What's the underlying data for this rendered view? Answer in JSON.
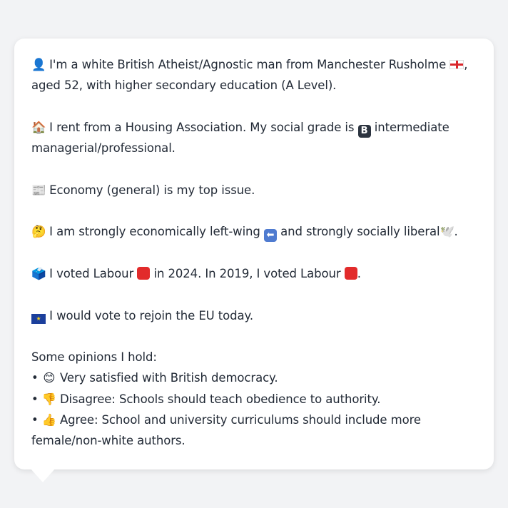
{
  "profile": {
    "line1a": "I'm a white British Atheist/Agnostic man from Manchester Rusholme",
    "line1b": "aged 52, with higher secondary education (A Level).",
    "line2a": "I rent from a Housing Association. My social grade is",
    "grade_badge": "B",
    "line2b": "intermediate",
    "line2c": "managerial/professional.",
    "line3": "Economy (general) is my top issue.",
    "line4a": "I am strongly economically left-wing",
    "line4b": "and strongly socially liberal",
    "line5a": "I voted Labour",
    "line5b": "in 2024. In 2019, I voted Labour",
    "line6": "I would vote to rejoin the EU today.",
    "opinions_heading": "Some opinions I hold:",
    "opinion1": "Very satisfied with British democracy.",
    "opinion2": "Disagree: Schools should teach obedience to authority.",
    "opinion3a": "Agree: School and university curriculums should include more",
    "opinion3b": "female/non-white authors."
  },
  "icons": {
    "person": "👤",
    "house": "🏠",
    "newspaper": "📰",
    "thinking": "🤔",
    "dove": "🕊️",
    "ballot": "🗳️",
    "smile": "😊",
    "thumbs_down": "👎",
    "thumbs_up": "👍"
  },
  "colors": {
    "labour_red": "#e22b2b",
    "background": "#f2f3f5",
    "text": "#222a36"
  }
}
